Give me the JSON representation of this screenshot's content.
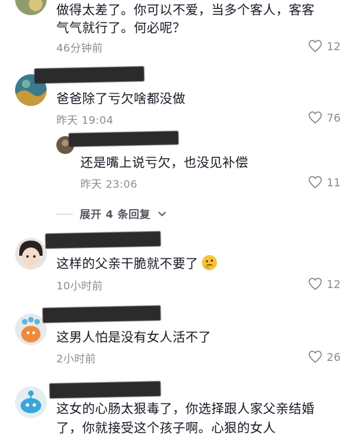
{
  "comments": [
    {
      "text_lines": [
        "做得太差了。你可以不爱，当多个客人，客客",
        "气气就行了。何必呢？"
      ],
      "time": "46分钟前",
      "likes": "12"
    },
    {
      "text_lines": [
        "爸爸除了亏欠啥都没做"
      ],
      "time": "昨天 19:04",
      "likes": "76",
      "reply": {
        "text": "还是嘴上说亏欠，也没见补偿",
        "time": "昨天 23:06",
        "likes": "11"
      },
      "expand_label": "展开 4 条回复"
    },
    {
      "text_lines": [
        "这样的父亲干脆就不要了"
      ],
      "time": "10小时前",
      "likes": "12"
    },
    {
      "text_lines": [
        "这男人怕是没有女人活不了"
      ],
      "time": "2小时前",
      "likes": "26"
    },
    {
      "text_lines": [
        "这女的心肠太狠毒了，你选择跟人家父亲结婚",
        "了，你就接受这个孩子啊。心狠的女人"
      ]
    }
  ],
  "icons": {
    "like": "heart-outline-icon",
    "expand": "chevron-down-icon"
  },
  "colors": {
    "text": "#161823",
    "meta": "#8a8b91"
  }
}
